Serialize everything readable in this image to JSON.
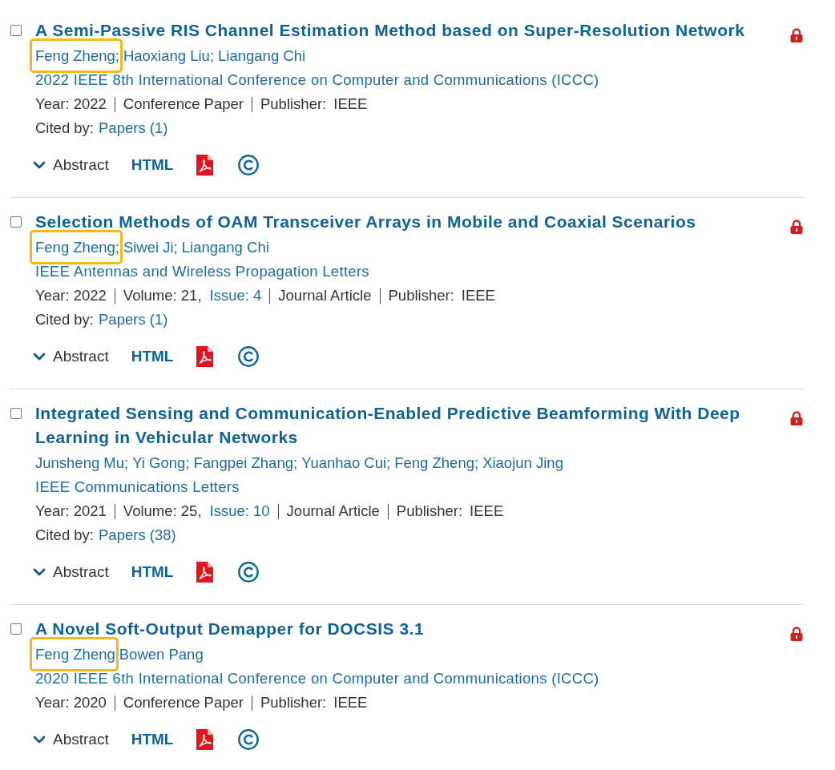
{
  "items": [
    {
      "title": "A Semi-Passive RIS Channel Estimation Method based on Super-Resolution Network",
      "checked": false,
      "locked": true,
      "authors": [
        {
          "name": "Feng Zheng;",
          "highlighted": true
        },
        {
          "name": "Haoxiang Liu;",
          "highlighted": false
        },
        {
          "name": "Liangang Chi",
          "highlighted": false
        }
      ],
      "venue": "2022 IEEE 8th International Conference on Computer and Communications (ICCC)",
      "meta": {
        "year": "Year: 2022",
        "type": "Conference Paper",
        "publisher_label": "Publisher:",
        "publisher": "IEEE"
      },
      "cited_by": {
        "label": "Cited by:",
        "link": "Papers (1)"
      },
      "actions": {
        "abstract": "Abstract",
        "expanded": false,
        "html": "HTML"
      }
    },
    {
      "title": "Selection Methods of OAM Transceiver Arrays in Mobile and Coaxial Scenarios",
      "checked": false,
      "locked": true,
      "authors": [
        {
          "name": "Feng Zheng;",
          "highlighted": true
        },
        {
          "name": "Siwei Ji;",
          "highlighted": false
        },
        {
          "name": "Liangang Chi",
          "highlighted": false
        }
      ],
      "venue": "IEEE Antennas and Wireless Propagation Letters",
      "meta": {
        "year": "Year: 2022",
        "volume": "Volume: 21,",
        "issue": "Issue: 4",
        "type": "Journal Article",
        "publisher_label": "Publisher:",
        "publisher": "IEEE"
      },
      "cited_by": {
        "label": "Cited by:",
        "link": "Papers (1)"
      },
      "actions": {
        "abstract": "Abstract",
        "expanded": false,
        "html": "HTML"
      }
    },
    {
      "title": "Integrated Sensing and Communication-Enabled Predictive Beamforming With Deep Learning in Vehicular Networks",
      "checked": false,
      "locked": true,
      "authors": [
        {
          "name": "Junsheng Mu;",
          "highlighted": false
        },
        {
          "name": "Yi Gong;",
          "highlighted": false
        },
        {
          "name": "Fangpei Zhang;",
          "highlighted": false
        },
        {
          "name": "Yuanhao Cui;",
          "highlighted": false
        },
        {
          "name": "Feng Zheng;",
          "highlighted": false
        },
        {
          "name": "Xiaojun Jing",
          "highlighted": false
        }
      ],
      "venue": "IEEE Communications Letters",
      "meta": {
        "year": "Year: 2021",
        "volume": "Volume: 25,",
        "issue": "Issue: 10",
        "type": "Journal Article",
        "publisher_label": "Publisher:",
        "publisher": "IEEE"
      },
      "cited_by": {
        "label": "Cited by:",
        "link": "Papers (38)"
      },
      "actions": {
        "abstract": "Abstract",
        "expanded": false,
        "html": "HTML"
      }
    },
    {
      "title": "A Novel Soft-Output Demapper for DOCSIS 3.1",
      "checked": false,
      "locked": true,
      "authors": [
        {
          "name": "Feng Zheng",
          "highlighted": true
        },
        {
          "name": "Bowen Pang",
          "highlighted": false
        }
      ],
      "venue": "2020 IEEE 6th International Conference on Computer and Communications (ICCC)",
      "meta": {
        "year": "Year: 2020",
        "type": "Conference Paper",
        "publisher_label": "Publisher:",
        "publisher": "IEEE"
      },
      "actions": {
        "abstract": "Abstract",
        "expanded": false,
        "html": "HTML"
      }
    }
  ]
}
